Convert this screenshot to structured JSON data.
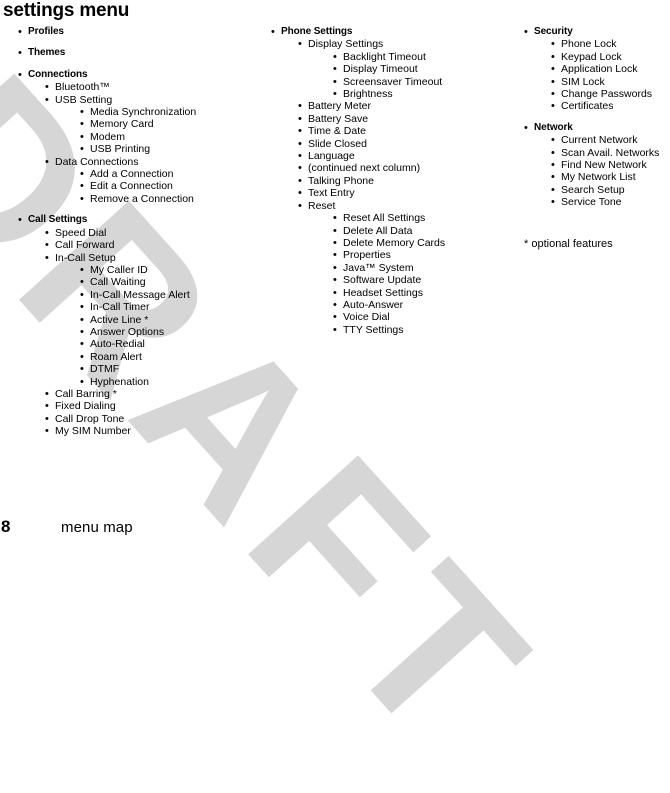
{
  "document": {
    "title": "settings menu",
    "watermark_text": "DRAFT",
    "watermark_color": "#d6d6d6",
    "text_color": "#000000",
    "background_color": "#ffffff"
  },
  "footer": {
    "page_number": "8",
    "section_title": "menu map"
  },
  "notes": {
    "optional_features": "* optional features"
  },
  "bullet_glyph": "•",
  "columns": [
    {
      "id": "column-1",
      "entries": [
        {
          "level": 1,
          "text": "Profiles",
          "first": true
        },
        {
          "level": 1,
          "text": "Themes"
        },
        {
          "level": 1,
          "text": "Connections"
        },
        {
          "level": 2,
          "text": "Bluetooth™"
        },
        {
          "level": 2,
          "text": "USB Setting"
        },
        {
          "level": 3,
          "text": "Media Synchronization"
        },
        {
          "level": 3,
          "text": "Memory Card"
        },
        {
          "level": 3,
          "text": "Modem"
        },
        {
          "level": 3,
          "text": "USB Printing"
        },
        {
          "level": 2,
          "text": "Data Connections"
        },
        {
          "level": 3,
          "text": "Add a Connection"
        },
        {
          "level": 3,
          "text": "Edit a Connection"
        },
        {
          "level": 3,
          "text": "Remove a Connection"
        },
        {
          "level": 1,
          "text": "Call Settings"
        },
        {
          "level": 2,
          "text": "Speed Dial"
        },
        {
          "level": 2,
          "text": "Call Forward"
        },
        {
          "level": 2,
          "text": "In-Call Setup"
        },
        {
          "level": 3,
          "text": "My Caller ID"
        },
        {
          "level": 3,
          "text": "Call Waiting"
        },
        {
          "level": 3,
          "text": "In-Call Message Alert"
        },
        {
          "level": 3,
          "text": "In-Call Timer"
        },
        {
          "level": 3,
          "text": "Active Line *"
        },
        {
          "level": 3,
          "text": "Answer Options"
        },
        {
          "level": 3,
          "text": "Auto-Redial"
        },
        {
          "level": 3,
          "text": "Roam Alert"
        },
        {
          "level": 3,
          "text": "DTMF"
        },
        {
          "level": 3,
          "text": "Hyphenation"
        },
        {
          "level": 2,
          "text": "Call Barring *"
        },
        {
          "level": 2,
          "text": "Fixed Dialing"
        },
        {
          "level": 2,
          "text": "Call Drop Tone"
        },
        {
          "level": 2,
          "text": "My SIM Number"
        }
      ]
    },
    {
      "id": "column-2",
      "entries": [
        {
          "level": 1,
          "text": "Phone Settings",
          "first": true
        },
        {
          "level": 2,
          "text": "Display Settings"
        },
        {
          "level": 3,
          "text": "Backlight Timeout"
        },
        {
          "level": 3,
          "text": "Display Timeout"
        },
        {
          "level": 3,
          "text": "Screensaver Timeout"
        },
        {
          "level": 3,
          "text": "Brightness"
        },
        {
          "level": 2,
          "text": "Battery Meter"
        },
        {
          "level": 2,
          "text": "Battery Save"
        },
        {
          "level": 2,
          "text": "Time & Date"
        },
        {
          "level": 2,
          "text": "Slide Closed"
        },
        {
          "level": 2,
          "text": "Language"
        },
        {
          "level": 2,
          "text": "(continued next column)"
        },
        {
          "level": 2,
          "text": "Talking Phone"
        },
        {
          "level": 2,
          "text": "Text Entry"
        },
        {
          "level": 2,
          "text": "Reset"
        },
        {
          "level": 3,
          "text": "Reset All Settings"
        },
        {
          "level": 3,
          "text": "Delete All Data"
        },
        {
          "level": 3,
          "text": "Delete Memory Cards"
        },
        {
          "level": 3,
          "text": "Properties"
        },
        {
          "level": 3,
          "text": "Java™ System"
        },
        {
          "level": 3,
          "text": "Software Update"
        },
        {
          "level": 3,
          "text": "Headset Settings"
        },
        {
          "level": 3,
          "text": "Auto-Answer"
        },
        {
          "level": 3,
          "text": "Voice Dial"
        },
        {
          "level": 3,
          "text": "TTY Settings"
        }
      ]
    },
    {
      "id": "column-3",
      "entries": [
        {
          "level": 1,
          "text": "Security",
          "first": true
        },
        {
          "level": 2,
          "text": "Phone Lock"
        },
        {
          "level": 2,
          "text": "Keypad Lock"
        },
        {
          "level": 2,
          "text": "Application Lock"
        },
        {
          "level": 2,
          "text": "SIM Lock"
        },
        {
          "level": 2,
          "text": "Change Passwords"
        },
        {
          "level": 2,
          "text": "Certificates"
        },
        {
          "level": 1,
          "text": "Network"
        },
        {
          "level": 2,
          "text": "Current Network"
        },
        {
          "level": 2,
          "text": "Scan Avail. Networks"
        },
        {
          "level": 2,
          "text": "Find New Network"
        },
        {
          "level": 2,
          "text": "My Network List"
        },
        {
          "level": 2,
          "text": "Search Setup"
        },
        {
          "level": 2,
          "text": "Service Tone"
        }
      ]
    }
  ]
}
